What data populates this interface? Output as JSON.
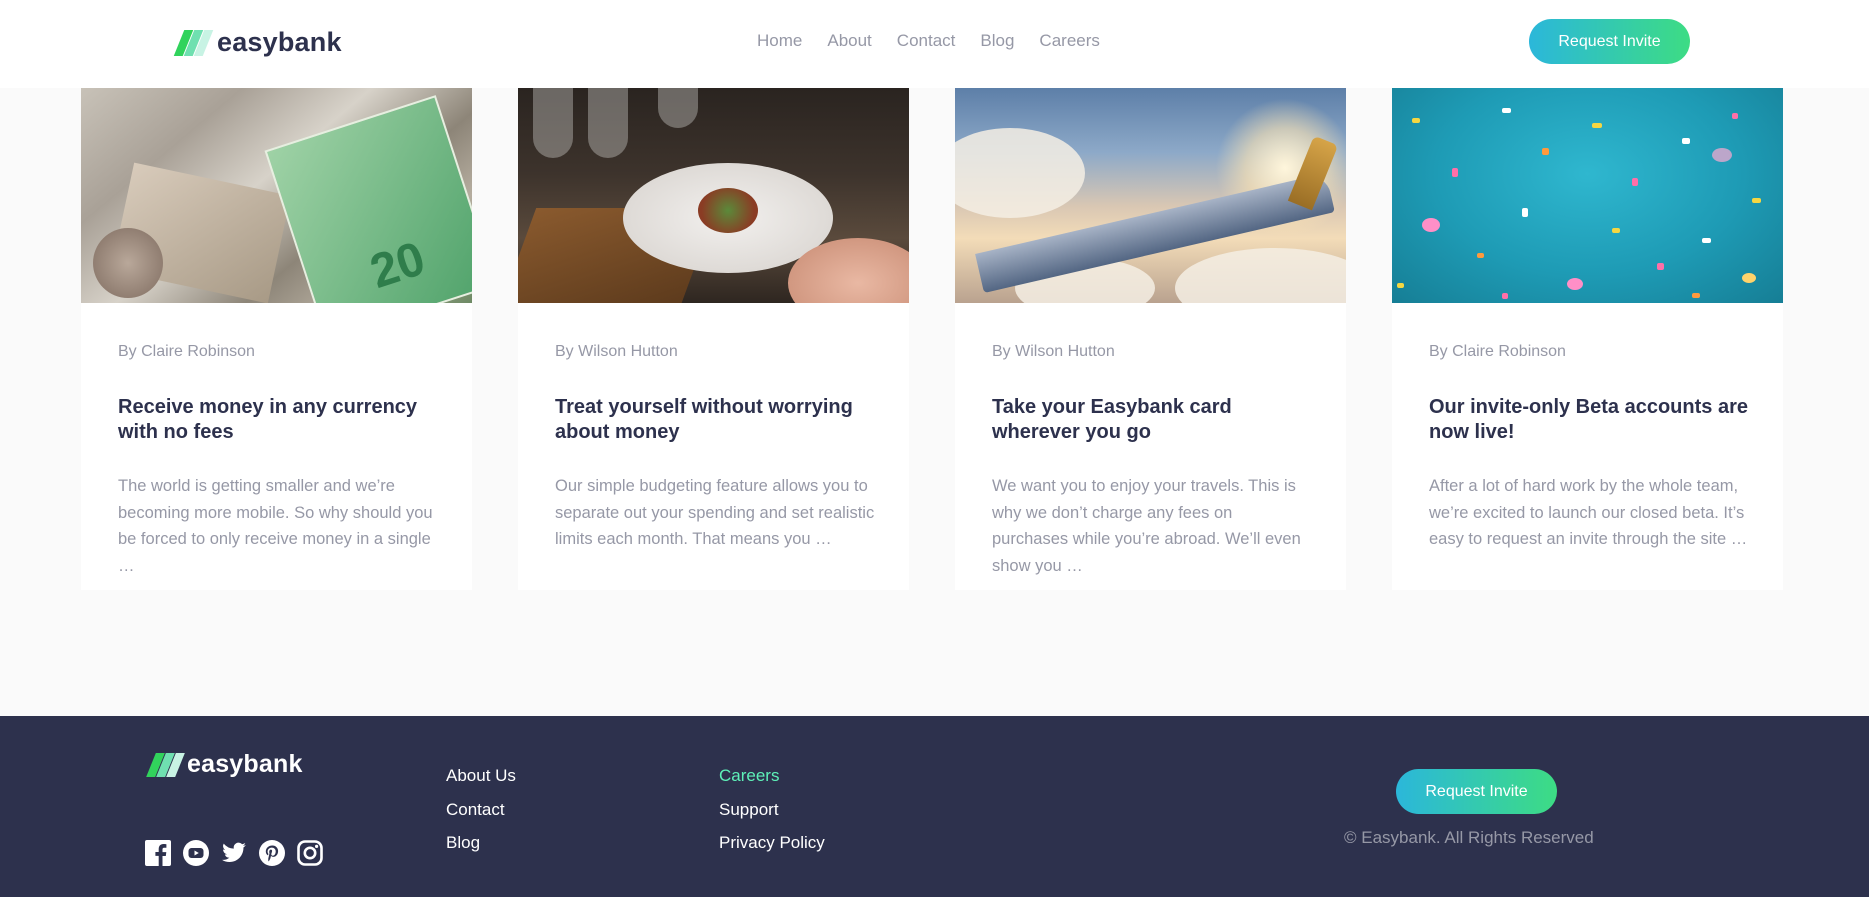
{
  "brand": {
    "name": "easybank"
  },
  "header": {
    "nav": [
      "Home",
      "About",
      "Contact",
      "Blog",
      "Careers"
    ],
    "cta": "Request Invite"
  },
  "articles": [
    {
      "author": "By Claire Robinson",
      "title": "Receive money in any currency with no fees",
      "excerpt": "The world is getting smaller and we’re becoming more mobile. So why should you be forced to only receive money in a single …"
    },
    {
      "author": "By Wilson Hutton",
      "title": "Treat yourself without worrying about money",
      "excerpt": "Our simple budgeting feature allows you to separate out your spending and set realistic limits each month. That means you …"
    },
    {
      "author": "By Wilson Hutton",
      "title": "Take your Easybank card wherever you go",
      "excerpt": "We want you to enjoy your travels. This is why we don’t charge any fees on purchases while you’re abroad. We’ll even show you …"
    },
    {
      "author": "By Claire Robinson",
      "title": "Our invite-only Beta accounts are now live!",
      "excerpt": "After a lot of hard work by the whole team, we’re excited to launch our closed beta. It’s easy to request an invite through the site …"
    }
  ],
  "footer": {
    "links_col1": [
      "About Us",
      "Contact",
      "Blog"
    ],
    "links_col2": [
      "Careers",
      "Support",
      "Privacy Policy"
    ],
    "cta": "Request Invite",
    "copyright": "© Easybank. All Rights Reserved",
    "social_icons": [
      "facebook-icon",
      "youtube-icon",
      "twitter-icon",
      "pinterest-icon",
      "instagram-icon"
    ]
  },
  "colors": {
    "dark_blue": "#2d314d",
    "lime_green": "#31d35c",
    "bright_cyan": "#2bb7da",
    "grayish_blue": "#9698a6",
    "light_grayish_blue": "#fafafa"
  }
}
